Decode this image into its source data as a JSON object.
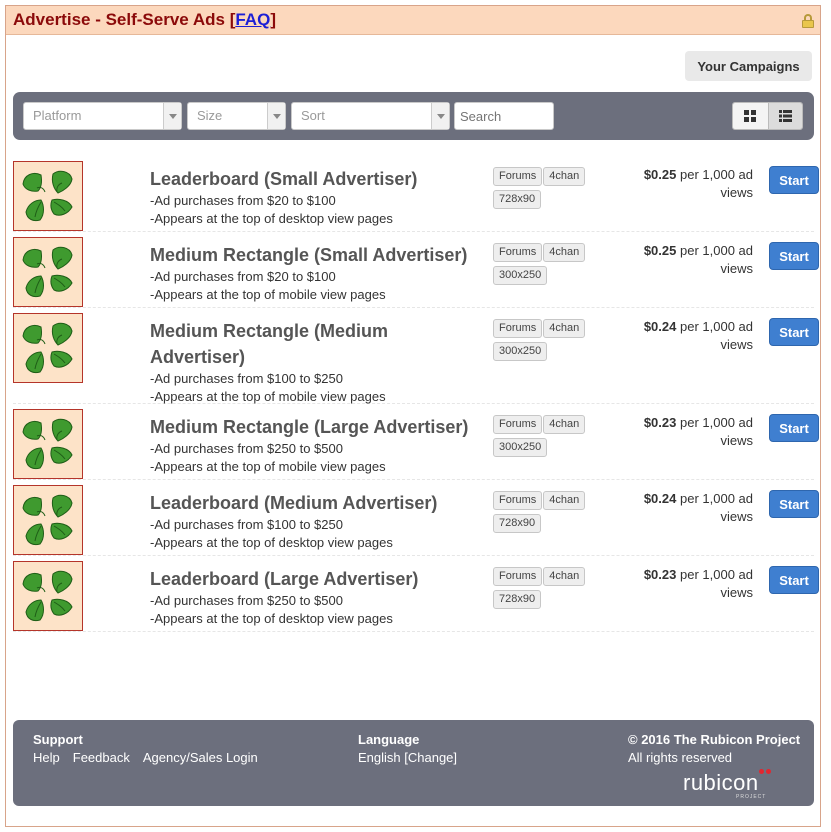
{
  "header": {
    "title": "Advertise - Self-Serve Ads",
    "faq_prefix": "[",
    "faq_label": "FAQ",
    "faq_suffix": "]",
    "lock_icon": "lock-icon"
  },
  "campaigns_button": "Your Campaigns",
  "filters": {
    "platform_placeholder": "Platform",
    "size_placeholder": "Size",
    "sort_placeholder": "Sort",
    "search_placeholder": "Search",
    "grid_view_icon": "grid-view-icon",
    "list_view_icon": "list-view-icon"
  },
  "ads": [
    {
      "title": "Leaderboard (Small Advertiser)",
      "range": "-Ad purchases from $20 to $100",
      "placement": "-Appears at the top of desktop view pages",
      "tags": [
        "Forums",
        "4chan",
        "728x90"
      ],
      "price": "$0.25",
      "price_unit": " per 1,000 ad views",
      "action": "Start"
    },
    {
      "title": "Medium Rectangle (Small Advertiser)",
      "range": "-Ad purchases from $20 to $100",
      "placement": "-Appears at the top of mobile view pages",
      "tags": [
        "Forums",
        "4chan",
        "300x250"
      ],
      "price": "$0.25",
      "price_unit": " per 1,000 ad views",
      "action": "Start"
    },
    {
      "title": "Medium Rectangle (Medium Advertiser)",
      "range": "-Ad purchases from $100 to $250",
      "placement": "-Appears at the top of mobile view pages",
      "tags": [
        "Forums",
        "4chan",
        "300x250"
      ],
      "price": "$0.24",
      "price_unit": " per 1,000 ad views",
      "action": "Start"
    },
    {
      "title": "Medium Rectangle (Large Advertiser)",
      "range": "-Ad purchases from $250 to $500",
      "placement": "-Appears at the top of mobile view pages",
      "tags": [
        "Forums",
        "4chan",
        "300x250"
      ],
      "price": "$0.23",
      "price_unit": " per 1,000 ad views",
      "action": "Start"
    },
    {
      "title": "Leaderboard (Medium Advertiser)",
      "range": "-Ad purchases from $100 to $250",
      "placement": "-Appears at the top of desktop view pages",
      "tags": [
        "Forums",
        "4chan",
        "728x90"
      ],
      "price": "$0.24",
      "price_unit": " per 1,000 ad views",
      "action": "Start"
    },
    {
      "title": "Leaderboard (Large Advertiser)",
      "range": "-Ad purchases from $250 to $500",
      "placement": "-Appears at the top of desktop view pages",
      "tags": [
        "Forums",
        "4chan",
        "728x90"
      ],
      "price": "$0.23",
      "price_unit": " per 1,000 ad views",
      "action": "Start"
    }
  ],
  "footer": {
    "support_heading": "Support",
    "support_links": [
      "Help",
      "Feedback",
      "Agency/Sales Login"
    ],
    "language_heading": "Language",
    "language_value": "English [Change]",
    "copyright": "© 2016 The Rubicon Project",
    "rights": "All rights reserved",
    "logo_text": "rubicon",
    "logo_subtext": "PROJECT"
  },
  "colors": {
    "title": "#8b0a0a",
    "titlebar_bg": "#fcd8bd",
    "toolbar_bg": "#6c6f7d",
    "start_button": "#3f7fd0",
    "logo_border": "#b5352a",
    "logo_bg": "#fde3c8",
    "leaf_green": "#3f9a2f"
  }
}
